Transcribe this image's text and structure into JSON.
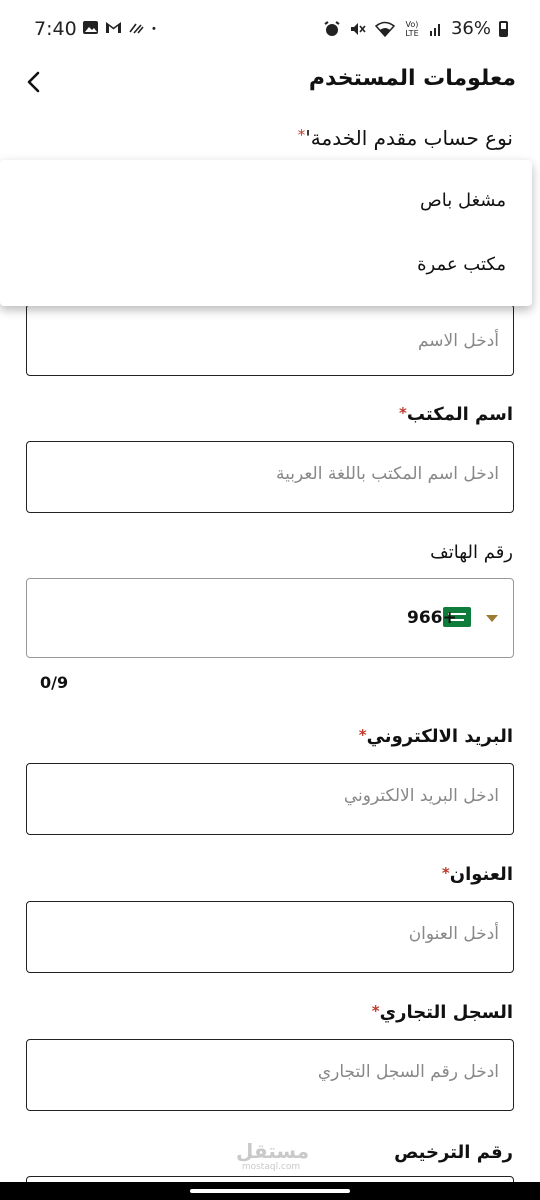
{
  "status_bar": {
    "time": "7:40",
    "left_icons": [
      "image-icon",
      "gmail-icon",
      "signal-waves-icon",
      "dot-icon"
    ],
    "right_icons": [
      "alarm-icon",
      "mute-icon",
      "wifi-icon",
      "volte-icon",
      "signal-icon"
    ],
    "volte_text": "Vo) LTE",
    "battery": "36%"
  },
  "header": {
    "title": "معلومات المستخدم",
    "back_icon": "chevron-left-icon"
  },
  "form": {
    "account_type_label": "نوع حساب مقدم الخدمة'",
    "required_mark": "*",
    "account_type_options": [
      "مشغل باص",
      "مكتب عمرة"
    ],
    "name_placeholder": "أدخل الاسم",
    "office_name_label": "اسم المكتب",
    "office_name_placeholder": "ادخل اسم المكتب باللغة العربية",
    "phone_label": "رقم الهاتف",
    "phone_dial_code": "966+",
    "phone_counter": "0/9",
    "email_label": "البريد الالكتروني",
    "email_placeholder": "ادخل البريد الالكتروني",
    "address_label": "العنوان",
    "address_placeholder": "أدخل العنوان",
    "commercial_reg_label": "السجل التجاري",
    "commercial_reg_placeholder": "ادخل رقم السجل التجاري",
    "license_label": "رقم الترخيص"
  },
  "watermark": {
    "main": "مستقل",
    "sub": "mostaql.com"
  },
  "colors": {
    "required": "#c0392b",
    "caret": "#9a7b2f",
    "flag": "#0e7c3a"
  }
}
